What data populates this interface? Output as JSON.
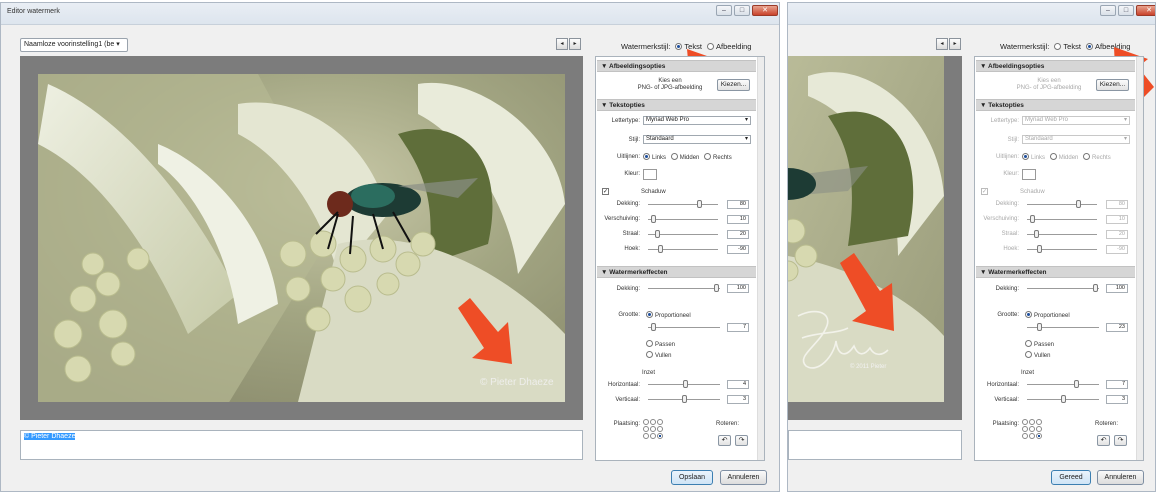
{
  "left_window": {
    "title": "Editor watermerk",
    "preset_dropdown": "Naamloze voorinstelling1 (be",
    "nav_prev": "◂",
    "nav_next": "▸",
    "watermark_type": {
      "label": "Watermerkstijl:",
      "text_option": "Tekst",
      "image_option": "Afbeelding",
      "selected": "Tekst"
    },
    "image_options": {
      "header": "Afbeeldingsopties",
      "hint_line1": "Kies een",
      "hint_line2": "PNG- of JPG-afbeelding",
      "choose_button": "Kiezen..."
    },
    "text_options": {
      "header": "Tekstopties",
      "font_label": "Lettertype:",
      "font_value": "Myriad Web Pro",
      "style_label": "Stijl:",
      "style_value": "Standaard",
      "align_label": "Uitlijnen:",
      "align_left": "Links",
      "align_center": "Midden",
      "align_right": "Rechts",
      "color_label": "Kleur:",
      "shadow_label": "Schaduw",
      "shadow_rows": [
        {
          "label": "Dekking:",
          "value": "80",
          "pos": 0.75
        },
        {
          "label": "Verschuiving:",
          "value": "10",
          "pos": 0.05
        },
        {
          "label": "Straal:",
          "value": "20",
          "pos": 0.1
        },
        {
          "label": "Hoek:",
          "value": "-90",
          "pos": 0.15
        }
      ]
    },
    "effects": {
      "header": "Watermerkeffecten",
      "opacity_label": "Dekking:",
      "opacity_value": "100",
      "opacity_pos": 0.98,
      "size_label": "Grootte:",
      "size_prop": "Proportioneel",
      "size_value": "7",
      "size_pos": 0.05,
      "fit_option": "Passen",
      "fill_option": "Vullen",
      "inset_label": "Inzet",
      "horiz_label": "Horizontaal:",
      "horiz_value": "4",
      "horiz_pos": 0.52,
      "vert_label": "Verticaal:",
      "vert_value": "3",
      "vert_pos": 0.5,
      "anchor_label": "Plaatsing:",
      "rotate_label": "Roteren:"
    },
    "watermark_text": "© Pieter Dhaeze",
    "textarea_value": "© Pieter Dhaeze",
    "save_button": "Opslaan",
    "cancel_button": "Annuleren"
  },
  "right_window": {
    "nav_prev": "◂",
    "nav_next": "▸",
    "watermark_type": {
      "label": "Watermerkstijl:",
      "text_option": "Tekst",
      "image_option": "Afbeelding",
      "selected": "Afbeelding"
    },
    "image_options": {
      "header": "Afbeeldingsopties",
      "hint_line1": "Kies een",
      "hint_line2": "PNG- of JPG-afbeelding",
      "choose_button": "Kiezen..."
    },
    "text_options": {
      "header": "Tekstopties",
      "font_label": "Lettertype:",
      "font_value": "Myriad Web Pro",
      "style_label": "Stijl:",
      "style_value": "Standaard",
      "align_label": "Uitlijnen:",
      "align_left": "Links",
      "align_center": "Midden",
      "align_right": "Rechts",
      "color_label": "Kleur:",
      "shadow_label": "Schaduw",
      "shadow_rows": [
        {
          "label": "Dekking:",
          "value": "80",
          "pos": 0.75
        },
        {
          "label": "Verschuiving:",
          "value": "10",
          "pos": 0.05
        },
        {
          "label": "Straal:",
          "value": "20",
          "pos": 0.1
        },
        {
          "label": "Hoek:",
          "value": "-90",
          "pos": 0.15
        }
      ]
    },
    "effects": {
      "header": "Watermerkeffecten",
      "opacity_label": "Dekking:",
      "opacity_value": "100",
      "opacity_pos": 0.98,
      "size_label": "Grootte:",
      "size_prop": "Proportioneel",
      "size_value": "23",
      "size_pos": 0.15,
      "fit_option": "Passen",
      "fill_option": "Vullen",
      "inset_label": "Inzet",
      "horiz_label": "Horizontaal:",
      "horiz_value": "7",
      "horiz_pos": 0.7,
      "vert_label": "Verticaal:",
      "vert_value": "3",
      "vert_pos": 0.5,
      "anchor_label": "Plaatsing:",
      "rotate_label": "Roteren:"
    },
    "watermark_caption": "© 2011 Pieter",
    "done_button": "Gereed",
    "cancel_button": "Annuleren"
  },
  "colors": {
    "accent_arrow": "#ee4d26",
    "window_bg": "#f0f0f0",
    "stage_bg": "#7c7c7c"
  }
}
